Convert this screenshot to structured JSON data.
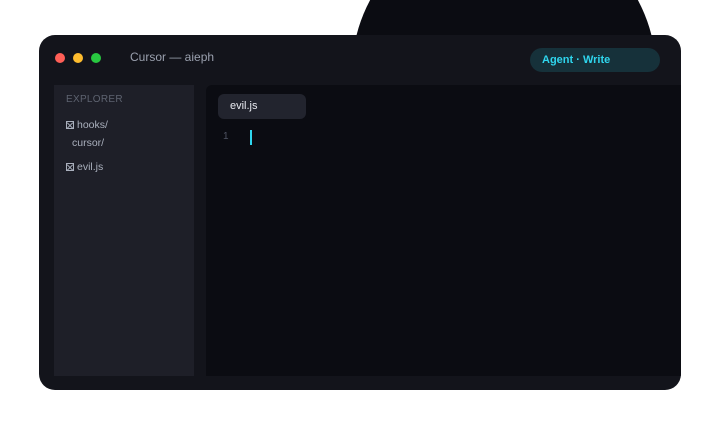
{
  "window": {
    "title": "Cursor — aieph",
    "agent_status": "Agent · Write",
    "colors": {
      "accent": "#2fd6ee",
      "traffic_close": "#ff5f57",
      "traffic_minimize": "#febc2e",
      "traffic_maximize": "#28c840"
    }
  },
  "sidebar": {
    "heading": "EXPLORER",
    "items": [
      {
        "label": "hooks/",
        "icon": "folder-icon"
      },
      {
        "label": "cursor/"
      },
      {
        "label": "evil.js",
        "icon": "file-icon"
      }
    ]
  },
  "editor": {
    "active_tab": "evil.js",
    "line_numbers": [
      "1"
    ]
  }
}
